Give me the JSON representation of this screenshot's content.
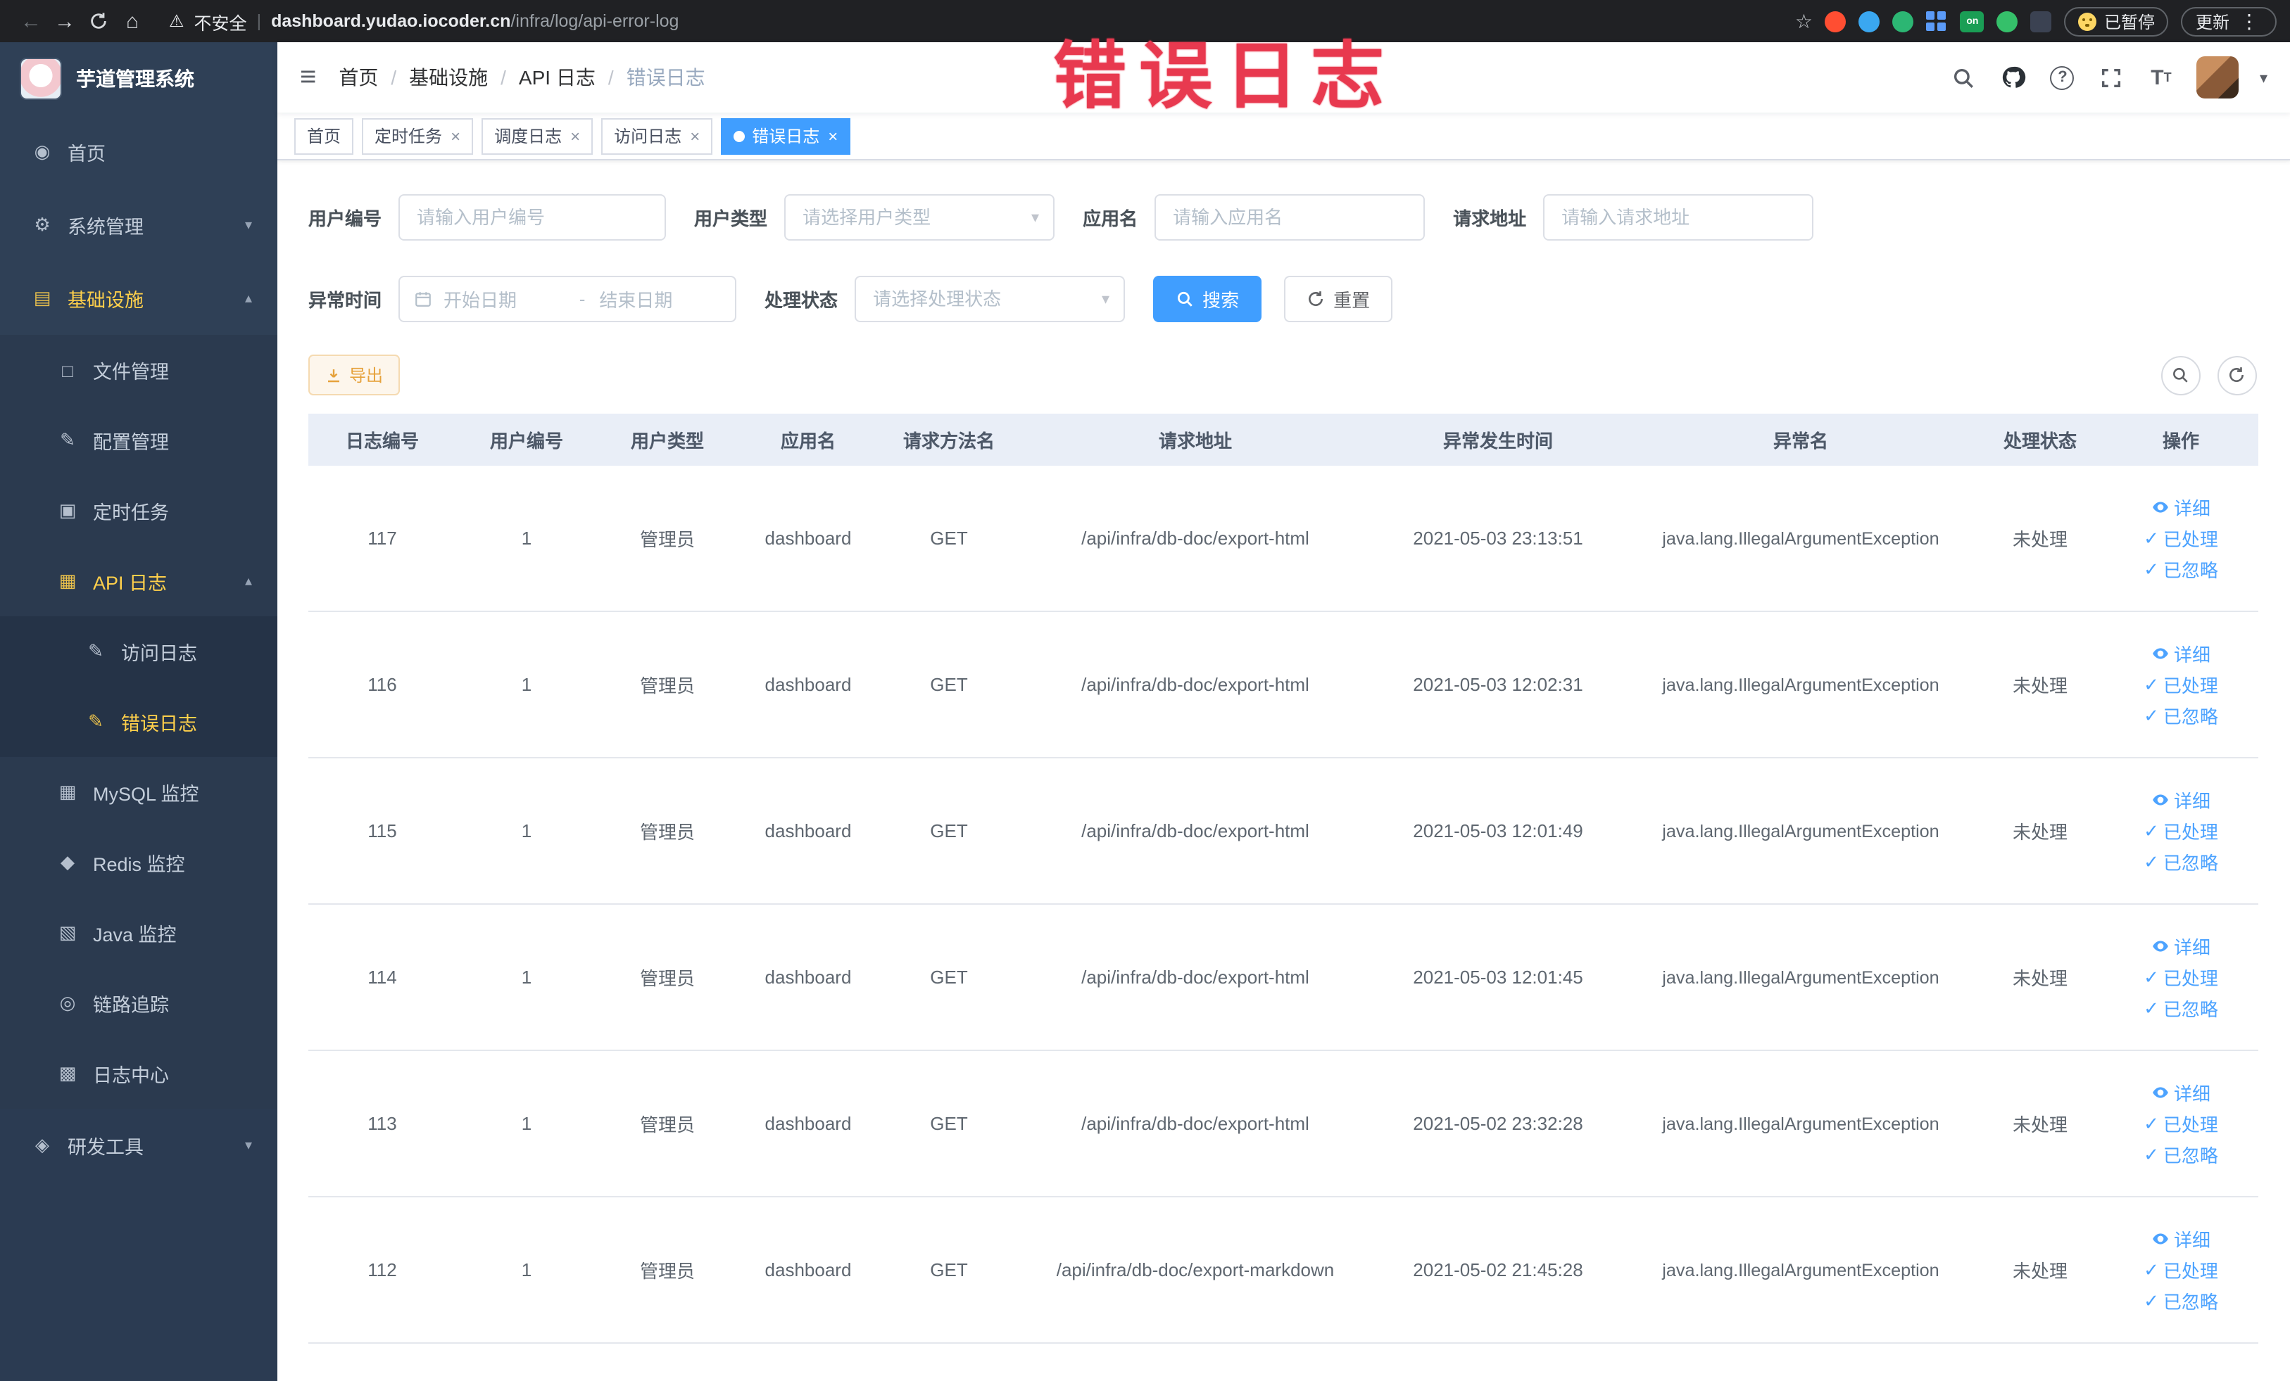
{
  "browser": {
    "security_label": "不安全",
    "url_domain": "dashboard.yudao.iocoder.cn",
    "url_path": "/infra/log/api-error-log",
    "extension_on_badge": "on",
    "paused_label": "已暂停",
    "update_label": "更新"
  },
  "annotation": {
    "text": "错误日志",
    "color": "#e8394f"
  },
  "sidebar": {
    "title": "芋道管理系统",
    "items": [
      {
        "label": "首页"
      },
      {
        "label": "系统管理"
      },
      {
        "label": "基础设施"
      },
      {
        "label": "文件管理"
      },
      {
        "label": "配置管理"
      },
      {
        "label": "定时任务"
      },
      {
        "label": "API 日志"
      },
      {
        "label": "访问日志"
      },
      {
        "label": "错误日志"
      },
      {
        "label": "MySQL 监控"
      },
      {
        "label": "Redis 监控"
      },
      {
        "label": "Java 监控"
      },
      {
        "label": "链路追踪"
      },
      {
        "label": "日志中心"
      },
      {
        "label": "研发工具"
      }
    ]
  },
  "navbar": {
    "breadcrumb": [
      "首页",
      "基础设施",
      "API 日志",
      "错误日志"
    ]
  },
  "tabs": [
    {
      "label": "首页"
    },
    {
      "label": "定时任务"
    },
    {
      "label": "调度日志"
    },
    {
      "label": "访问日志"
    },
    {
      "label": "错误日志"
    }
  ],
  "filters": {
    "user_id_label": "用户编号",
    "user_id_placeholder": "请输入用户编号",
    "user_type_label": "用户类型",
    "user_type_placeholder": "请选择用户类型",
    "app_name_label": "应用名",
    "app_name_placeholder": "请输入应用名",
    "request_url_label": "请求地址",
    "request_url_placeholder": "请输入请求地址",
    "exception_time_label": "异常时间",
    "start_date_placeholder": "开始日期",
    "range_separator": "-",
    "end_date_placeholder": "结束日期",
    "process_status_label": "处理状态",
    "process_status_placeholder": "请选择处理状态",
    "search_button": "搜索",
    "reset_button": "重置"
  },
  "toolbar": {
    "export_button": "导出"
  },
  "table": {
    "columns": [
      "日志编号",
      "用户编号",
      "用户类型",
      "应用名",
      "请求方法名",
      "请求地址",
      "异常发生时间",
      "异常名",
      "处理状态",
      "操作"
    ],
    "actions": {
      "detail": "详细",
      "processed": "已处理",
      "ignored": "已忽略"
    },
    "rows": [
      {
        "id": "117",
        "user_id": "1",
        "user_type": "管理员",
        "app_name": "dashboard",
        "method": "GET",
        "url": "/api/infra/db-doc/export-html",
        "time": "2021-05-03 23:13:51",
        "exception": "java.lang.IllegalArgumentException",
        "status": "未处理"
      },
      {
        "id": "116",
        "user_id": "1",
        "user_type": "管理员",
        "app_name": "dashboard",
        "method": "GET",
        "url": "/api/infra/db-doc/export-html",
        "time": "2021-05-03 12:02:31",
        "exception": "java.lang.IllegalArgumentException",
        "status": "未处理"
      },
      {
        "id": "115",
        "user_id": "1",
        "user_type": "管理员",
        "app_name": "dashboard",
        "method": "GET",
        "url": "/api/infra/db-doc/export-html",
        "time": "2021-05-03 12:01:49",
        "exception": "java.lang.IllegalArgumentException",
        "status": "未处理"
      },
      {
        "id": "114",
        "user_id": "1",
        "user_type": "管理员",
        "app_name": "dashboard",
        "method": "GET",
        "url": "/api/infra/db-doc/export-html",
        "time": "2021-05-03 12:01:45",
        "exception": "java.lang.IllegalArgumentException",
        "status": "未处理"
      },
      {
        "id": "113",
        "user_id": "1",
        "user_type": "管理员",
        "app_name": "dashboard",
        "method": "GET",
        "url": "/api/infra/db-doc/export-html",
        "time": "2021-05-02 23:32:28",
        "exception": "java.lang.IllegalArgumentException",
        "status": "未处理"
      },
      {
        "id": "112",
        "user_id": "1",
        "user_type": "管理员",
        "app_name": "dashboard",
        "method": "GET",
        "url": "/api/infra/db-doc/export-markdown",
        "time": "2021-05-02 21:45:28",
        "exception": "java.lang.IllegalArgumentException",
        "status": "未处理"
      }
    ]
  }
}
